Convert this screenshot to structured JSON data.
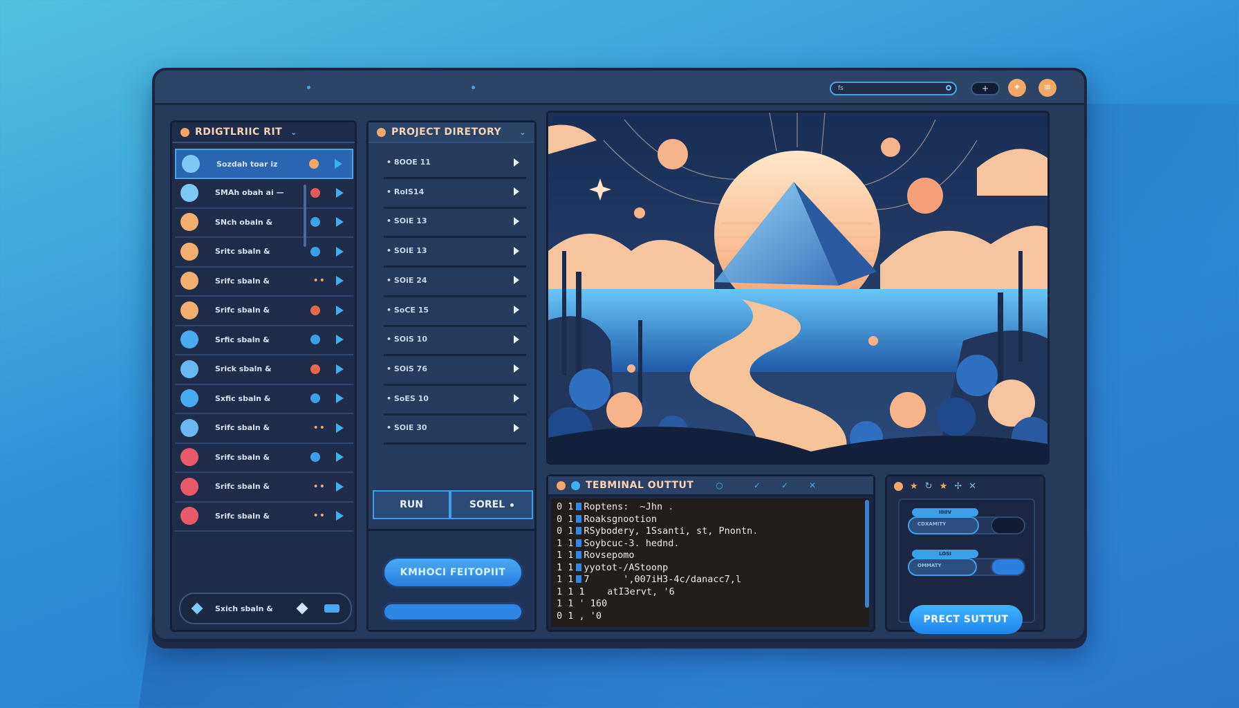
{
  "titlebar": {
    "search_value": "fs",
    "plus_label": "+"
  },
  "left_panel": {
    "title": "RDIGTLRIIC RIT",
    "items": [
      {
        "label": "Sozdah toar iz",
        "avatar": "#7ec8f6",
        "right": "badge-dots",
        "badge": "#f2a868"
      },
      {
        "label": "SMAh obah ai —",
        "avatar": "#7ec8f6",
        "right": "badge",
        "badge": "#e85a5a"
      },
      {
        "label": "SNch obaln &",
        "avatar": "#f2b070",
        "right": "badge",
        "badge": "#3aa0ea"
      },
      {
        "label": "Sritc sbaln &",
        "avatar": "#f2b070",
        "right": "badge",
        "badge": "#3aa0ea"
      },
      {
        "label": "Srifc sbaln &",
        "avatar": "#f2b070",
        "right": "dots",
        "badge": "#f2a868"
      },
      {
        "label": "Srifc sbaln &",
        "avatar": "#f2b070",
        "right": "badge",
        "badge": "#e86a4a"
      },
      {
        "label": "Srfic sbaln &",
        "avatar": "#4aaaf0",
        "right": "badge",
        "badge": "#3aa0ea"
      },
      {
        "label": "Srick sbaln &",
        "avatar": "#6ab8f2",
        "right": "badge",
        "badge": "#e86a4a"
      },
      {
        "label": "Sxfic sbaln &",
        "avatar": "#4aaaf0",
        "right": "badge",
        "badge": "#3aa0ea"
      },
      {
        "label": "Srifc sbaln &",
        "avatar": "#6ab8f2",
        "right": "dots",
        "badge": "#f2a868"
      },
      {
        "label": "Srifc sbaln &",
        "avatar": "#e85a6a",
        "right": "badge",
        "badge": "#3aa0ea"
      },
      {
        "label": "Srifc sbaln &",
        "avatar": "#e85a6a",
        "right": "dots",
        "badge": "#f2a868"
      },
      {
        "label": "Srifc sbaln &",
        "avatar": "#e85a6a",
        "right": "dots",
        "badge": "#f2a868"
      }
    ],
    "footer_label": "Sxich sbaln &"
  },
  "mid_panel": {
    "title": "PROJECT DIRETORY",
    "items": [
      "8OOE 11",
      "RoIS14",
      "SOiE 13",
      "SOiE 13",
      "SOiE 24",
      "SoCE 15",
      "SOiS 10",
      "SOiS 76",
      "SoES 10",
      "SOiE 30"
    ],
    "run_label": "RUN",
    "sort_label": "SOREL",
    "primary_button": "KMHOCI FEITOPIIT"
  },
  "terminal": {
    "title": "TEBMINAL OUTTUT",
    "lines": [
      {
        "prefix": "0 1",
        "marker": true,
        "text": "Roptens:  ~Jhn ."
      },
      {
        "prefix": "0 1",
        "marker": true,
        "text": "Roaksgnootion"
      },
      {
        "prefix": "0 1",
        "marker": true,
        "text": "RSybodery, 1Ssanti, st, Pnontn."
      },
      {
        "prefix": "1 1",
        "marker": true,
        "text": "Soybcuc-3. hednd."
      },
      {
        "prefix": "1 1",
        "marker": true,
        "text": "Rovsepomo"
      },
      {
        "prefix": "1 1",
        "marker": true,
        "text": "yyotot-/AStoonp"
      },
      {
        "prefix": "1 1",
        "marker": true,
        "text": "7      ',007iH3-4c/danacc7,l"
      },
      {
        "prefix": "1 1 1",
        "marker": false,
        "text": "   atI3ervt, '6"
      },
      {
        "prefix": "1 1 '",
        "marker": false,
        "text": "160"
      },
      {
        "prefix": "0 1 ,",
        "marker": false,
        "text": "'0"
      }
    ]
  },
  "controls": {
    "slider1_label": "I0IIV",
    "slider1_sub": "CDXAMITY",
    "slider1_fill": 0.62,
    "slider2_label": "LOSI",
    "slider2_sub": "OMMATY",
    "slider2_fill": 0.6,
    "action_button": "PRECT SUTTUT"
  },
  "colors": {
    "accent": "#3aa0ea",
    "orange": "#f2a868",
    "panel": "#1f2d4a"
  }
}
